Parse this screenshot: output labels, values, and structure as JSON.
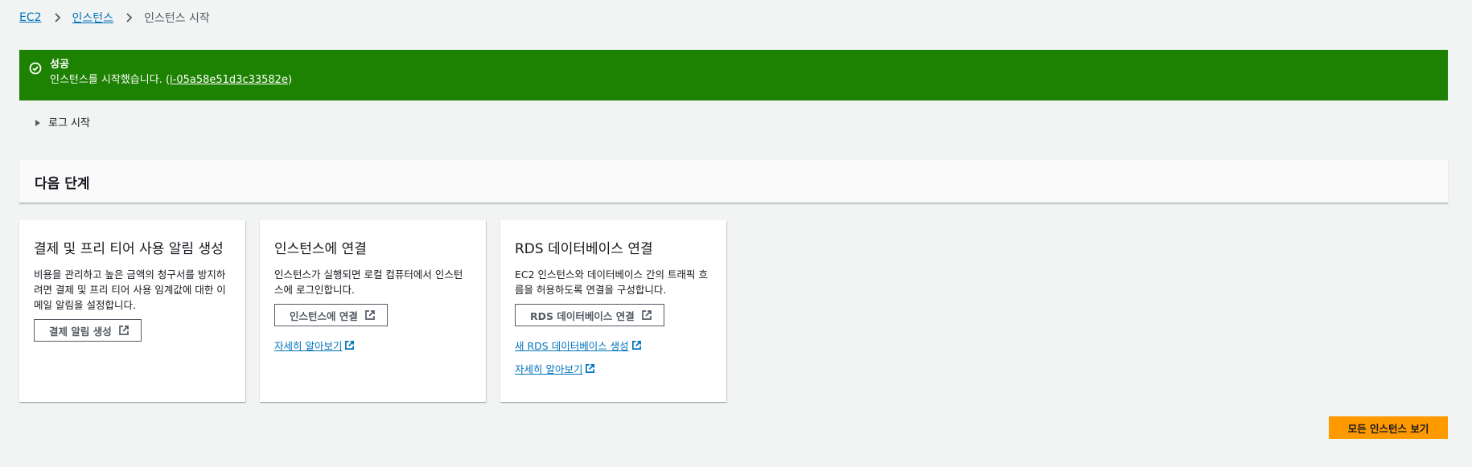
{
  "breadcrumb": {
    "items": [
      {
        "label": "EC2"
      },
      {
        "label": "인스턴스"
      }
    ],
    "current": "인스턴스 시작"
  },
  "flash": {
    "type": "success",
    "title": "성공",
    "message_prefix": "인스턴스를 시작했습니다. (",
    "instance_id": "i-05a58e51d3c33582e",
    "message_suffix": ")",
    "color": "#1d8102"
  },
  "log": {
    "label": "로그 시작"
  },
  "next_steps": {
    "title": "다음 단계"
  },
  "cards": [
    {
      "title": "결제 및 프리 티어 사용 알림 생성",
      "description": "비용을 관리하고 높은 금액의 청구서를 방지하려면 결제 및 프리 티어 사용 임계값에 대한 이메일 알림을 설정합니다.",
      "button": "결제 알림 생성"
    },
    {
      "title": "인스턴스에 연결",
      "description": "인스턴스가 실행되면 로컬 컴퓨터에서 인스턴스에 로그인합니다.",
      "button": "인스턴스에 연결",
      "links": [
        "자세히 알아보기"
      ]
    },
    {
      "title": "RDS 데이터베이스 연결",
      "description": "EC2 인스턴스와 데이터베이스 간의 트래픽 흐름을 허용하도록 연결을 구성합니다.",
      "button": "RDS 데이터베이스 연결",
      "links": [
        "새 RDS 데이터베이스 생성",
        "자세히 알아보기"
      ]
    }
  ],
  "footer": {
    "view_all_button": "모든 인스턴스 보기"
  },
  "colors": {
    "link": "#0073bb",
    "primary": "#ff9900",
    "background": "#f2f3f3"
  },
  "icons": {
    "breadcrumb_separator": "chevron-right-icon",
    "flash": "success-check-icon",
    "log_toggle": "caret-right-icon",
    "external": "external-link-icon"
  }
}
